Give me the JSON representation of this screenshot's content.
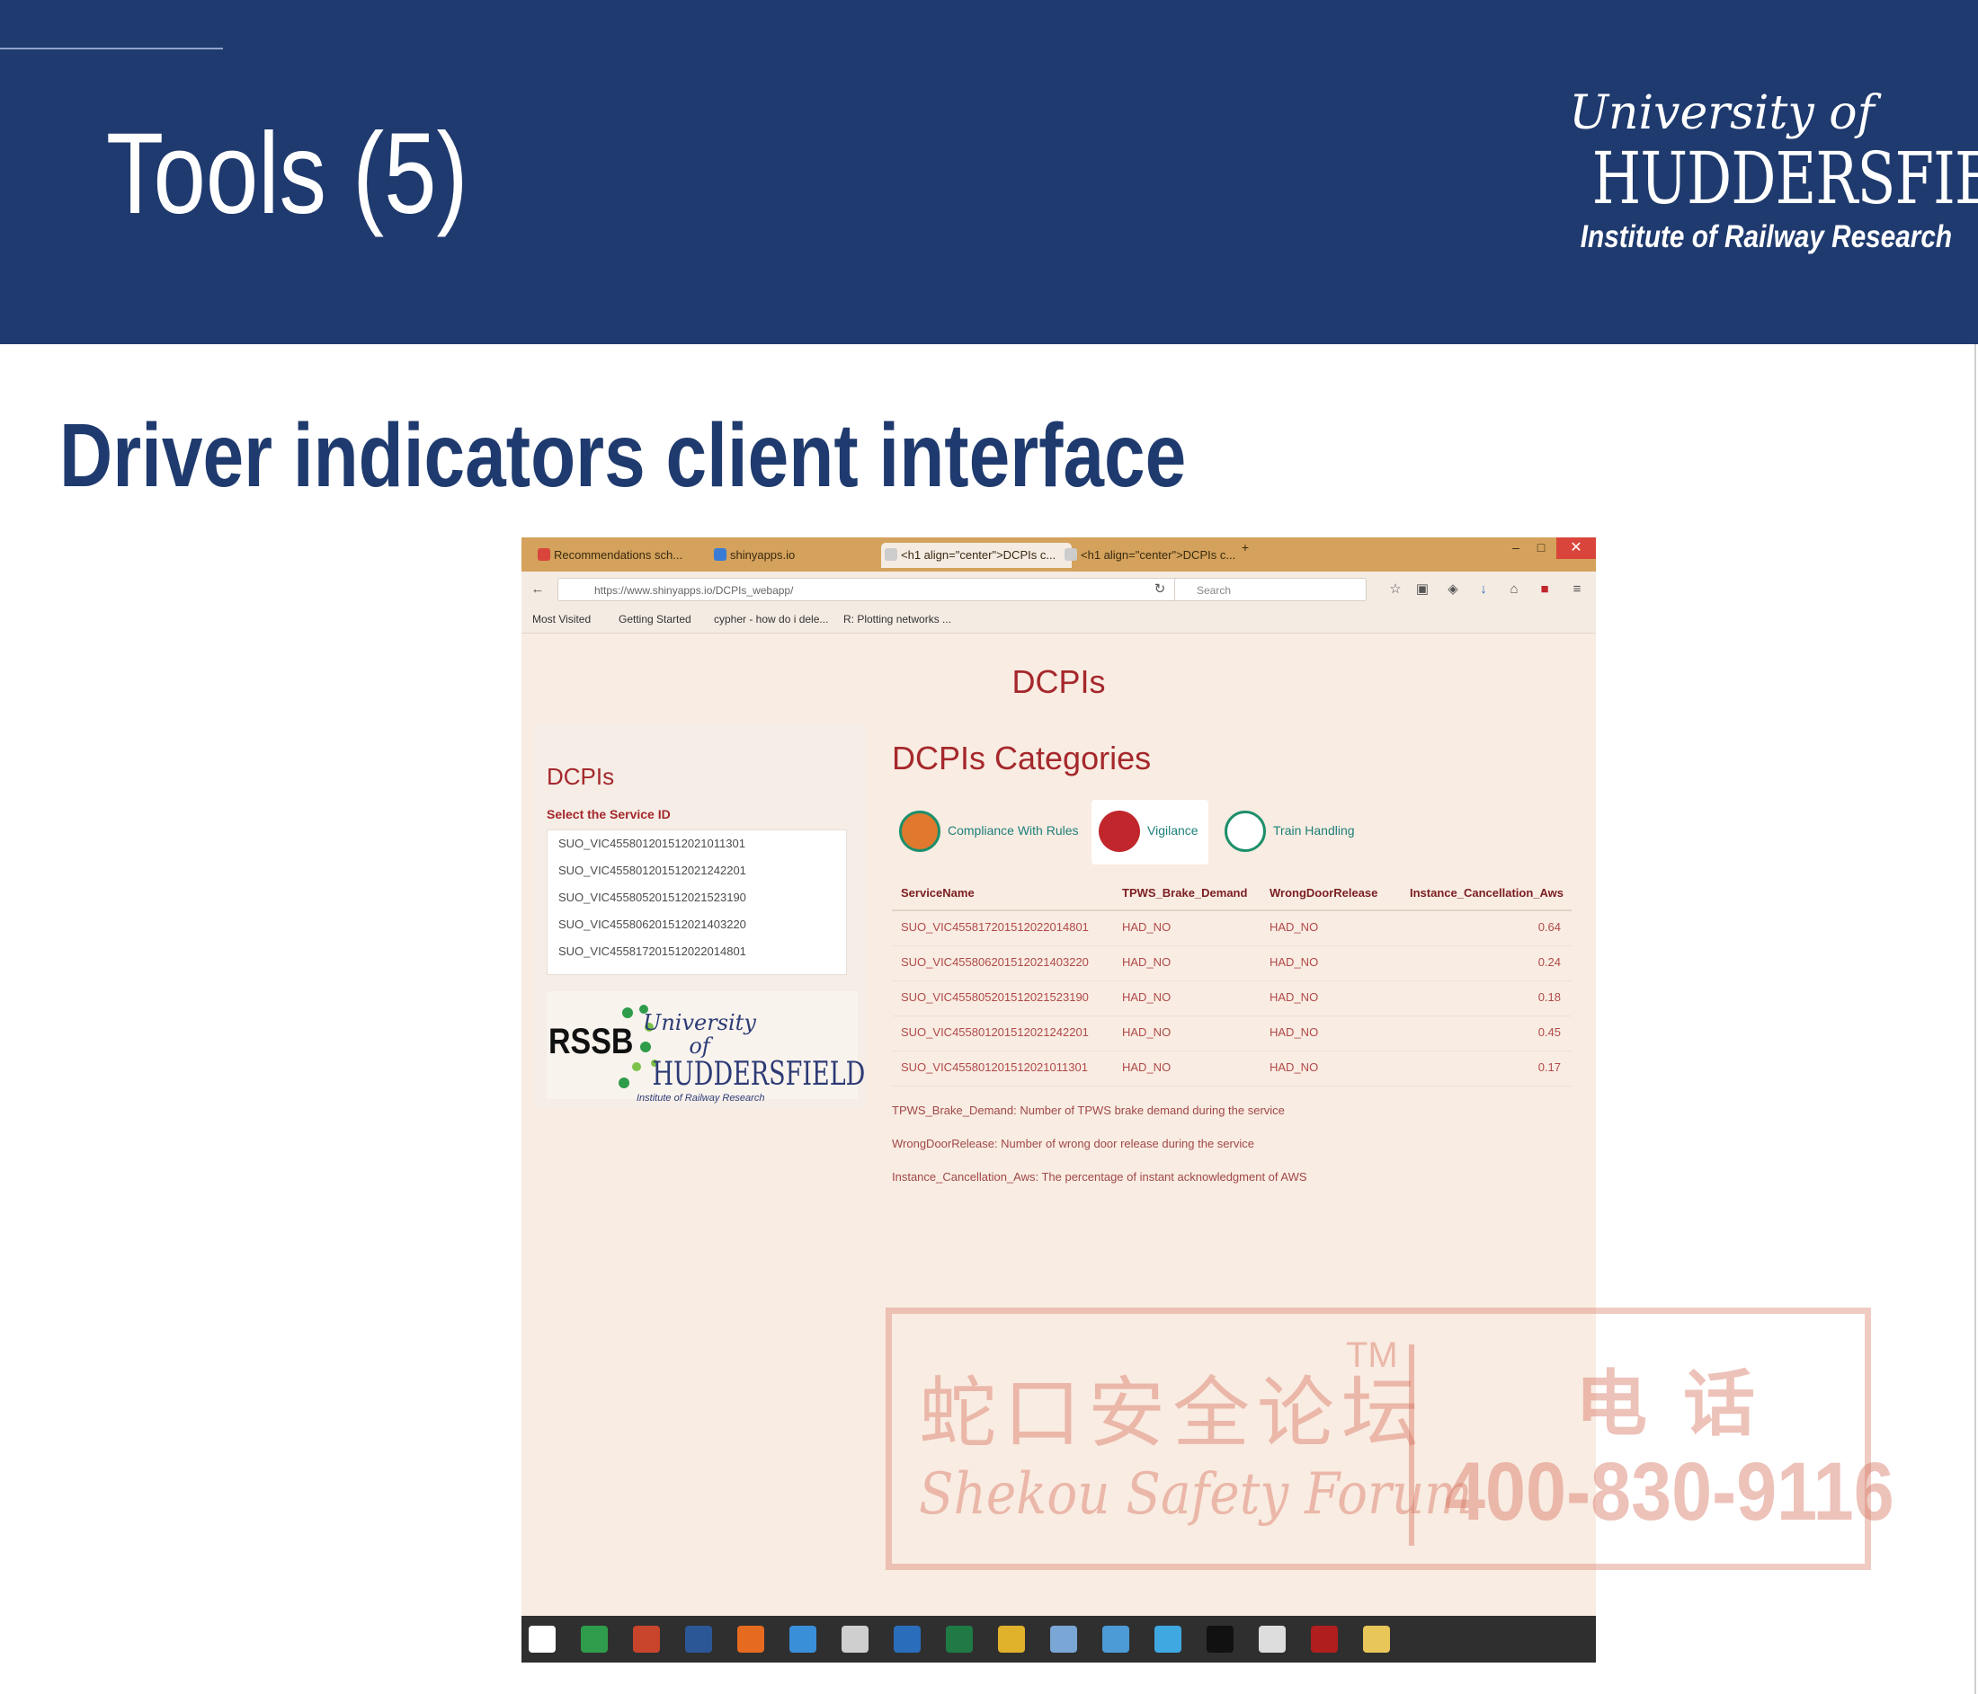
{
  "slide": {
    "title": "Tools (5)",
    "subtitle": "Driver indicators client interface",
    "logo": {
      "line1": "University of",
      "line2": "HUDDERSFIELD",
      "line3": "Institute of Railway Research"
    }
  },
  "browser": {
    "tabs": [
      {
        "label": "Recommendations sch...",
        "icon_color": "#d9453a"
      },
      {
        "label": "shinyapps.io",
        "icon_color": "#3a7bd5"
      },
      {
        "label": "<h1 align=\"center\">DCPIs c...",
        "icon_color": "#cccccc"
      },
      {
        "label": "<h1 align=\"center\">DCPIs c...",
        "icon_color": "#cccccc"
      }
    ],
    "url": "https://www.shinyapps.io/DCPIs_webapp/",
    "search_placeholder": "Search",
    "bookmarks": [
      "Most Visited",
      "Getting Started",
      "cypher - how do i dele...",
      "R: Plotting networks ..."
    ]
  },
  "app": {
    "heading": "DCPIs",
    "sidebar": {
      "title": "DCPIs",
      "select_label": "Select the Service ID",
      "services": [
        "SUO_VIC455801201512021011301",
        "SUO_VIC455801201512021242201",
        "SUO_VIC455805201512021523190",
        "SUO_VIC455806201512021403220",
        "SUO_VIC455817201512022014801"
      ],
      "partner_logo_text": "RSSB",
      "uni_logo": {
        "a": "University of",
        "b": "HUDDERSFIELD",
        "c": "Institute of Railway Research"
      }
    },
    "categories_title": "DCPIs Categories",
    "categories": [
      {
        "label": "Compliance With Rules",
        "icon_color": "#e0792e"
      },
      {
        "label": "Vigilance",
        "icon_color": "#c0262c"
      },
      {
        "label": "Train Handling",
        "icon_color": "#1d8f6b"
      }
    ],
    "table": {
      "headers": [
        "ServiceName",
        "TPWS_Brake_Demand",
        "WrongDoorRelease",
        "Instance_Cancellation_Aws"
      ],
      "rows": [
        [
          "SUO_VIC455817201512022014801",
          "HAD_NO",
          "HAD_NO",
          "0.64"
        ],
        [
          "SUO_VIC455806201512021403220",
          "HAD_NO",
          "HAD_NO",
          "0.24"
        ],
        [
          "SUO_VIC455805201512021523190",
          "HAD_NO",
          "HAD_NO",
          "0.18"
        ],
        [
          "SUO_VIC455801201512021242201",
          "HAD_NO",
          "HAD_NO",
          "0.45"
        ],
        [
          "SUO_VIC455801201512021011301",
          "HAD_NO",
          "HAD_NO",
          "0.17"
        ]
      ]
    },
    "notes": [
      "TPWS_Brake_Demand: Number of TPWS brake demand during the service",
      "WrongDoorRelease: Number of wrong door release during the service",
      "Instance_Cancellation_Aws: The percentage of instant acknowledgment of AWS"
    ]
  },
  "taskbar_icons": [
    {
      "name": "windows-start-icon",
      "color": "#ffffff"
    },
    {
      "name": "store-icon",
      "color": "#2e9c4a"
    },
    {
      "name": "powerpoint-icon",
      "color": "#c8452c"
    },
    {
      "name": "word-icon",
      "color": "#2b5797"
    },
    {
      "name": "firefox-icon",
      "color": "#e66a1f"
    },
    {
      "name": "internet-explorer-icon",
      "color": "#3a8fd9"
    },
    {
      "name": "calculator-icon",
      "color": "#cfcfcf"
    },
    {
      "name": "outlook-icon",
      "color": "#2a6ebb"
    },
    {
      "name": "excel-icon",
      "color": "#1f7a45"
    },
    {
      "name": "chrome-icon",
      "color": "#e0b12a"
    },
    {
      "name": "network-icon",
      "color": "#7aa6d6"
    },
    {
      "name": "r-studio-icon",
      "color": "#4c9bd6"
    },
    {
      "name": "skype-icon",
      "color": "#3fa8e0"
    },
    {
      "name": "terminal-icon",
      "color": "#111111"
    },
    {
      "name": "printer-icon",
      "color": "#dddddd"
    },
    {
      "name": "acrobat-icon",
      "color": "#b01e1e"
    },
    {
      "name": "folder-icon",
      "color": "#e8c65a"
    }
  ],
  "watermark": {
    "cn": "蛇口安全论坛",
    "tm": "TM",
    "en": "Shekou Safety Forum",
    "phone_label": "电话",
    "phone": "400-830-9116"
  }
}
